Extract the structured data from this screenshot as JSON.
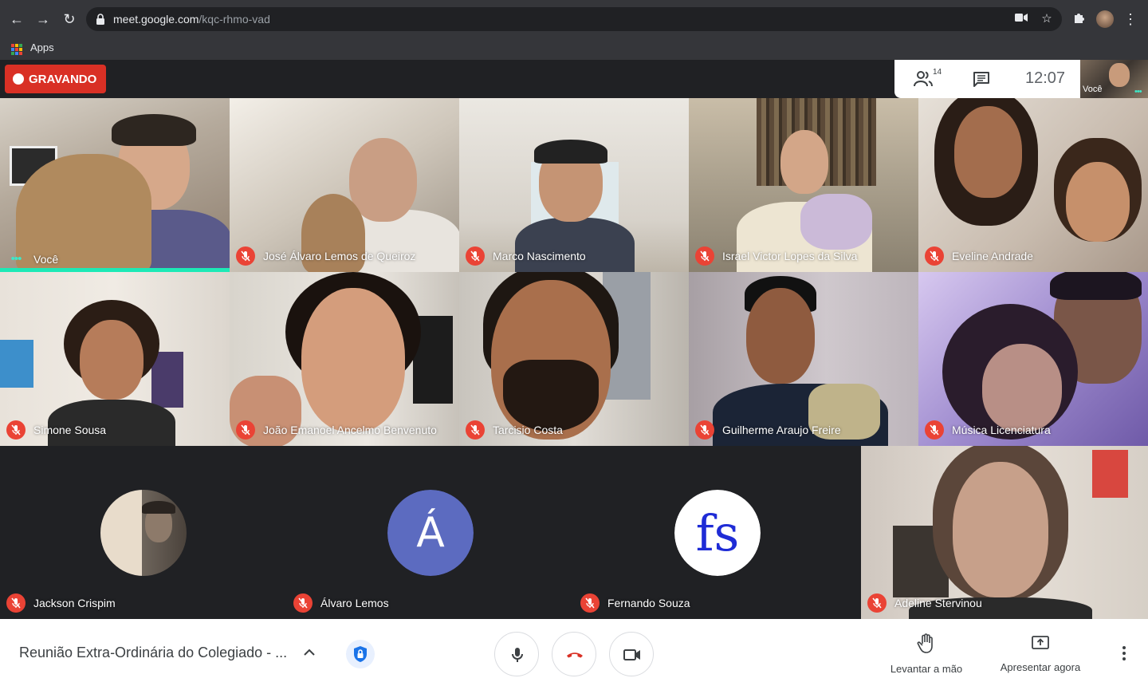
{
  "browser": {
    "url_host": "meet.google.com",
    "url_path": "/kqc-rhmo-vad",
    "bookmark_apps": "Apps"
  },
  "meet": {
    "recording_label": "GRAVANDO",
    "participants_count": "14",
    "clock": "12:07",
    "self_label": "Você"
  },
  "tiles": [
    {
      "name": "Você",
      "speaking": true
    },
    {
      "name": "José Álvaro Lemos de Queiroz",
      "muted": true
    },
    {
      "name": "Marco Nascimento",
      "muted": true
    },
    {
      "name": "Israel Victor Lopes da Silva",
      "muted": true
    },
    {
      "name": "Eveline Andrade",
      "muted": true
    },
    {
      "name": "Simone Sousa",
      "muted": true
    },
    {
      "name": "João Emanoel Ancelmo Benvenuto",
      "muted": true
    },
    {
      "name": "Tarcisio Costa",
      "muted": true
    },
    {
      "name": "Guilherme Araujo Freire",
      "muted": true
    },
    {
      "name": "Música Licenciatura",
      "muted": true
    }
  ],
  "bottom_row": [
    {
      "name": "Jackson Crispim",
      "avatar": "photo"
    },
    {
      "name": "Álvaro Lemos",
      "avatar_letter": "Á"
    },
    {
      "name": "Fernando Souza",
      "avatar_text": "fs"
    },
    {
      "name": "Adeline Stervinou",
      "avatar": "video"
    }
  ],
  "toolbar": {
    "meeting_title": "Reunião Extra-Ordinária do Colegiado - ...",
    "raise_hand": "Levantar a mão",
    "present_now": "Apresentar agora"
  },
  "colors": {
    "recording_red": "#d93025",
    "mute_red": "#ea4335",
    "speaking_teal": "#1de9b6",
    "avatar_purple": "#5c6bc0"
  }
}
